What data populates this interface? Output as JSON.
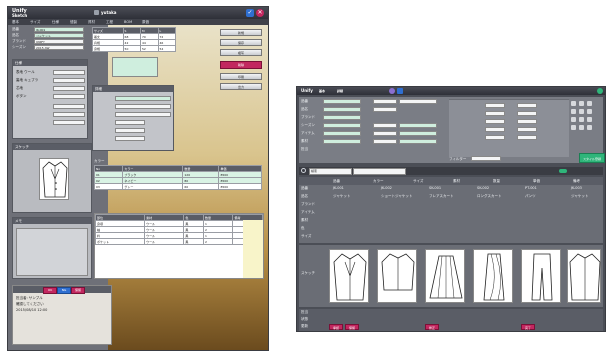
{
  "left_window": {
    "title": "Unify",
    "subtitle": "Sketch",
    "toolbar_user": "yutaka",
    "menu": [
      "基本",
      "サイズ",
      "仕様",
      "縫製",
      "資材",
      "工程",
      "BOM",
      "原価"
    ],
    "form_labels": [
      "品番",
      "品名",
      "ブランド",
      "シーズン",
      "アイテム"
    ],
    "form_values": [
      "JK-001",
      "ジャケット",
      "UNIFY",
      "2015 AW",
      "アウター"
    ],
    "size_grid_headers": [
      "サイズ",
      "S",
      "M",
      "L"
    ],
    "size_grid_rows": [
      {
        "label": "着丈",
        "values": [
          "68",
          "70",
          "72"
        ]
      },
      {
        "label": "肩幅",
        "values": [
          "42",
          "44",
          "46"
        ]
      },
      {
        "label": "身幅",
        "values": [
          "50",
          "52",
          "54"
        ]
      }
    ],
    "material_rows": [
      "表地 ウール",
      "裏地 キュプラ",
      "芯地",
      "ボタン"
    ],
    "sketch_label": "スケッチ",
    "memo_label": "メモ",
    "colors_label": "カラー",
    "color_table_headers": [
      "No",
      "カラー",
      "数量",
      "単価"
    ],
    "color_table_rows": [
      [
        "01",
        "ブラック",
        "120",
        "8500"
      ],
      [
        "02",
        "ネイビー",
        "80",
        "8500"
      ],
      [
        "03",
        "グレー",
        "60",
        "8500"
      ]
    ],
    "parts_table_headers": [
      "部位",
      "素材",
      "色",
      "数量",
      "備考"
    ],
    "parts_table_rows": [
      [
        "身頃",
        "ウール",
        "黒",
        "1",
        ""
      ],
      [
        "袖",
        "ウール",
        "黒",
        "2",
        ""
      ],
      [
        "衿",
        "ウール",
        "黒",
        "1",
        ""
      ],
      [
        "ポケット",
        "ウール",
        "黒",
        "2",
        ""
      ]
    ],
    "side_buttons": [
      "新規",
      "保存",
      "複写",
      "削除",
      "印刷",
      "出力"
    ],
    "chat_lines": [
      "担当者: サンプル",
      "確認してください",
      "2015/08/10 12:00"
    ],
    "chat_tags": [
      "OK",
      "NG",
      "保留"
    ]
  },
  "right_window": {
    "title": "Unify",
    "header_tabs": [
      "基本",
      "詳細"
    ],
    "search_placeholder": "検索",
    "filter_label": "フィルター",
    "action_button": "スタイル登録",
    "form_labels": [
      "品番",
      "品名",
      "ブランド",
      "シーズン",
      "アイテム",
      "素材",
      "担当"
    ],
    "column_headers": [
      "品番",
      "カラー",
      "サイズ",
      "素材",
      "数量",
      "単価",
      "備考"
    ],
    "row_labels": [
      "品番",
      "品名",
      "ブランド",
      "アイテム",
      "素材",
      "色",
      "サイズ"
    ],
    "styles": [
      {
        "code": "JK-001",
        "name": "ジャケット"
      },
      {
        "code": "JK-002",
        "name": "ショートジャケット"
      },
      {
        "code": "SK-001",
        "name": "フレアスカート"
      },
      {
        "code": "SK-002",
        "name": "ロングスカート"
      },
      {
        "code": "PT-001",
        "name": "パンツ"
      },
      {
        "code": "JK-003",
        "name": "ジャケット"
      }
    ],
    "sketch_row_label": "スケッチ",
    "footer_labels": [
      "担当",
      "状態",
      "更新"
    ],
    "footer_tags": [
      "承認",
      "保留",
      "修正",
      "完了"
    ]
  },
  "colors": {
    "accent_green": "#2fb57a",
    "accent_red": "#c2275f",
    "accent_blue": "#2f6fd1",
    "window_bg": "#6e7078",
    "field_green": "#cfeede"
  }
}
